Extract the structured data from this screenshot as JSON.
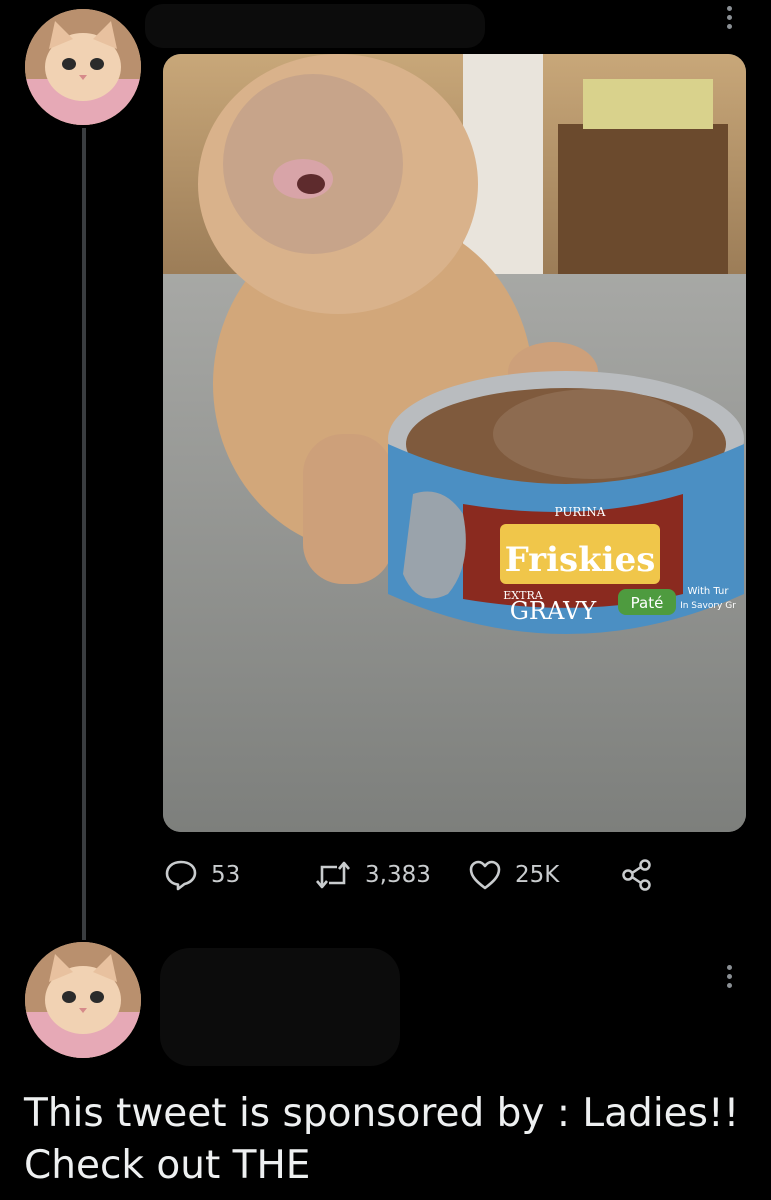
{
  "tweet": {
    "avatar_icon": "cat-avatar",
    "more_icon": "more-dots-icon",
    "media": {
      "can_label_top": "PURINA",
      "can_brand": "Friskies",
      "can_label_extra": "EXTRA",
      "can_label_gravy": "GRAVY",
      "can_label_pate": "Paté",
      "can_label_side": "With Tur",
      "can_label_side2": "In Savory Gr"
    },
    "actions": {
      "reply_icon": "reply-bubble-icon",
      "reply_count": "53",
      "retweet_icon": "retweet-icon",
      "retweet_count": "3,383",
      "like_icon": "heart-icon",
      "like_count": "25K",
      "share_icon": "share-icon"
    }
  },
  "reply": {
    "avatar_icon": "cat-avatar",
    "more_icon": "more-dots-icon",
    "text": "This tweet is sponsored by : Ladies!! Check out THE"
  },
  "colors": {
    "background": "#000000",
    "text": "#e7e9ea",
    "muted": "#8b9095",
    "thread_line": "#3a3d40"
  }
}
